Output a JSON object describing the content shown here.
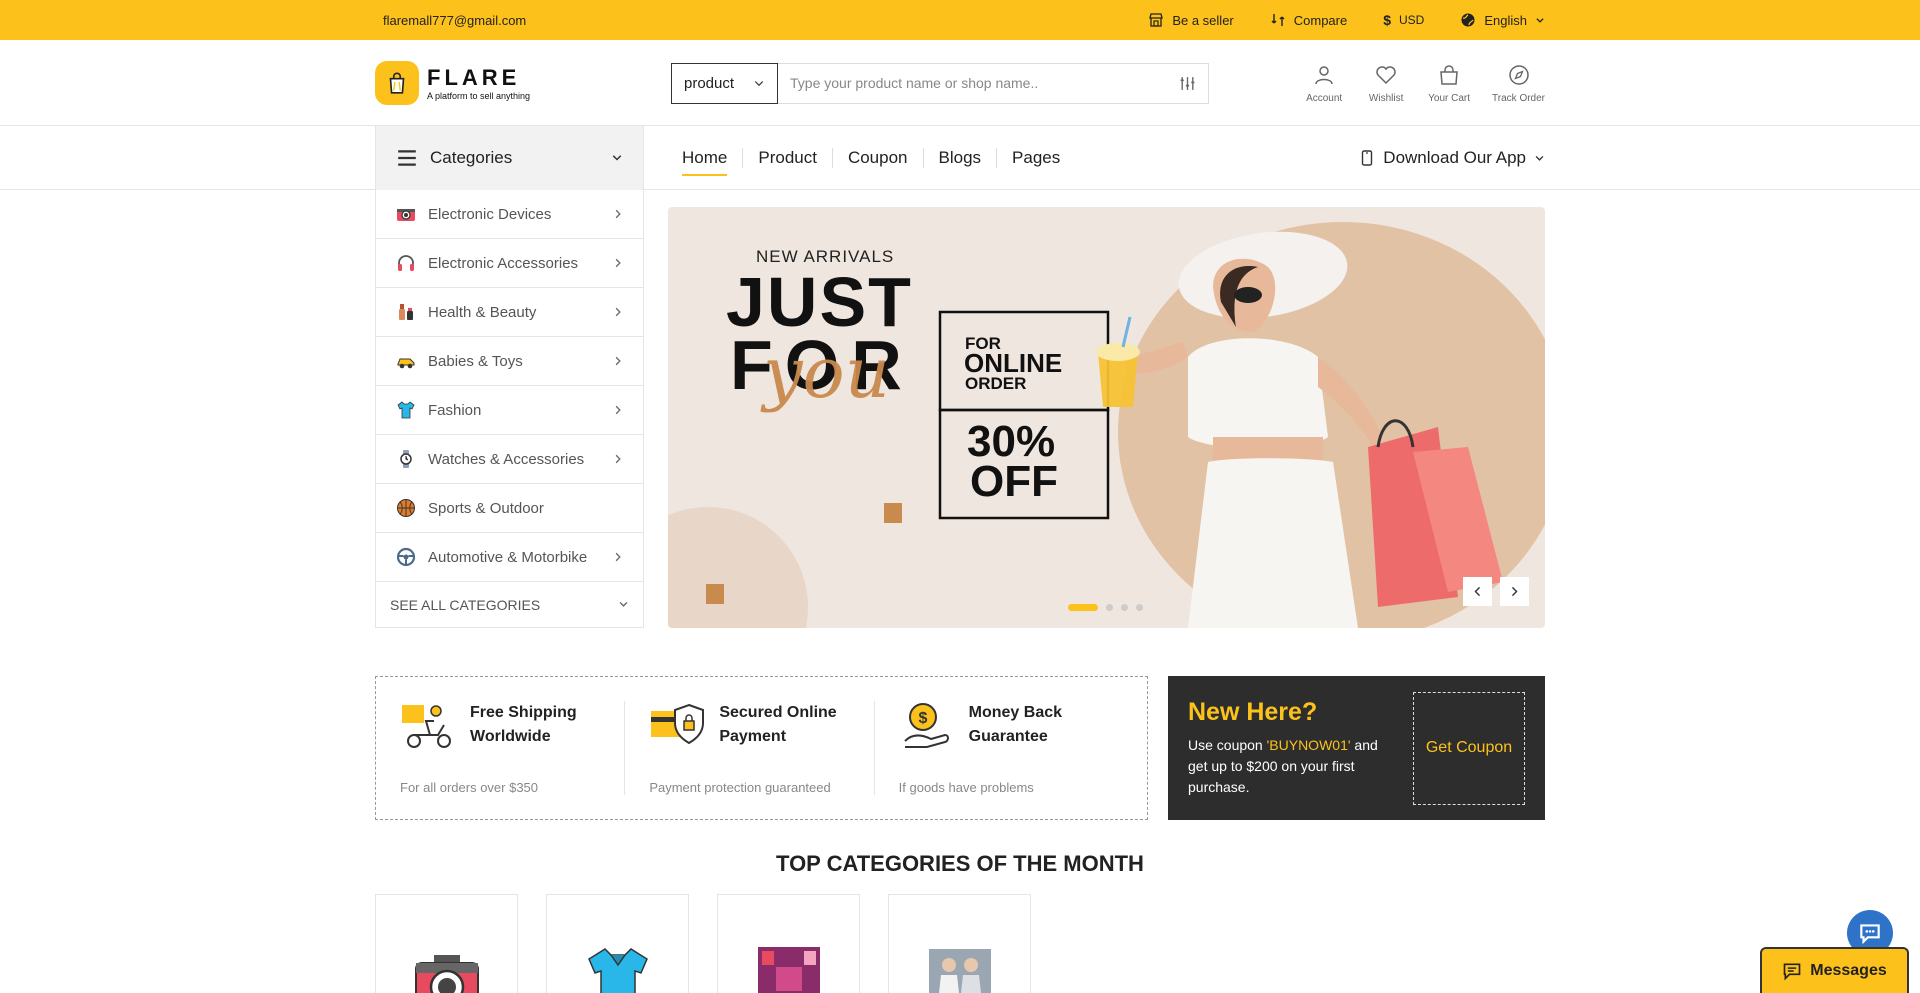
{
  "topbar": {
    "email": "flaremall777@gmail.com",
    "seller": "Be a seller",
    "compare": "Compare",
    "currency_symbol": "$",
    "currency": "USD",
    "language": "English"
  },
  "header": {
    "brand": "FLARE",
    "tagline": "A platform to sell anything",
    "search_category": "product",
    "search_placeholder": "Type your product name or shop name..",
    "icons": [
      {
        "label": "Account",
        "icon": "user-icon"
      },
      {
        "label": "Wishlist",
        "icon": "heart-icon"
      },
      {
        "label": "Your Cart",
        "icon": "bag-icon"
      },
      {
        "label": "Track Order",
        "icon": "compass-icon"
      }
    ]
  },
  "nav": {
    "categories_label": "Categories",
    "items": [
      "Home",
      "Product",
      "Coupon",
      "Blogs",
      "Pages"
    ],
    "active": "Home",
    "download_app": "Download Our App"
  },
  "sidebar": {
    "items": [
      {
        "label": "Electronic Devices",
        "icon": "camera-icon",
        "has_sub": true
      },
      {
        "label": "Electronic Accessories",
        "icon": "headphones-icon",
        "has_sub": true
      },
      {
        "label": "Health & Beauty",
        "icon": "cosmetics-icon",
        "has_sub": true
      },
      {
        "label": "Babies & Toys",
        "icon": "toy-car-icon",
        "has_sub": true
      },
      {
        "label": "Fashion",
        "icon": "tshirt-icon",
        "has_sub": true
      },
      {
        "label": "Watches & Accessories",
        "icon": "watch-icon",
        "has_sub": true
      },
      {
        "label": "Sports & Outdoor",
        "icon": "basketball-icon",
        "has_sub": false
      },
      {
        "label": "Automotive & Motorbike",
        "icon": "steering-wheel-icon",
        "has_sub": true
      }
    ],
    "see_all": "SEE ALL CATEGORIES"
  },
  "hero": {
    "kicker": "NEW ARRIVALS",
    "line1": "JUST",
    "line2": "FOR",
    "script": "you",
    "for": "FOR",
    "online": "ONLINE",
    "order": "ORDER",
    "discount": "30%",
    "off": "OFF",
    "slides": 4,
    "active_slide": 1
  },
  "features": [
    {
      "title": "Free Shipping Worldwide",
      "sub": "For all orders over $350",
      "icon": "delivery-scooter-icon"
    },
    {
      "title": "Secured Online Payment",
      "sub": "Payment protection guaranteed",
      "icon": "secure-card-icon"
    },
    {
      "title": "Money Back Guarantee",
      "sub": "If goods have problems",
      "icon": "money-back-icon"
    }
  ],
  "coupon": {
    "title": "New Here?",
    "text_before": "Use coupon ",
    "code": "'BUYNOW01'",
    "text_after": " and get up to $200 on your first purchase.",
    "button": "Get Coupon"
  },
  "top_categories": {
    "title": "TOP CATEGORIES OF THE MONTH",
    "items": [
      {
        "icon": "camera-icon"
      },
      {
        "icon": "polo-shirt-icon"
      },
      {
        "icon": "book-cover-icon"
      },
      {
        "icon": "fashion-photo-icon"
      }
    ]
  },
  "widgets": {
    "messages": "Messages"
  },
  "colors": {
    "accent": "#fcc21b",
    "dark": "#2d2d2d",
    "chat": "#2f73c9"
  }
}
